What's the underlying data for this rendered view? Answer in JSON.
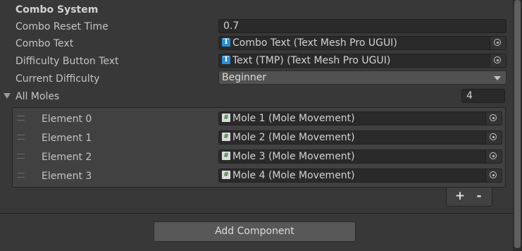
{
  "section": {
    "title": "Combo System"
  },
  "properties": {
    "combo_reset_time": {
      "label": "Combo Reset Time",
      "value": "0.7"
    },
    "combo_text": {
      "label": "Combo Text",
      "value": "Combo Text (Text Mesh Pro UGUI)",
      "icon": "textmeshpro-icon"
    },
    "difficulty_button_text": {
      "label": "Difficulty Button Text",
      "value": "Text (TMP) (Text Mesh Pro UGUI)",
      "icon": "textmeshpro-icon"
    },
    "current_difficulty": {
      "label": "Current Difficulty",
      "value": "Beginner"
    }
  },
  "all_moles": {
    "label": "All Moles",
    "count": "4",
    "elements": [
      {
        "label": "Element 0",
        "value": "Mole 1 (Mole Movement)",
        "icon": "script-icon"
      },
      {
        "label": "Element 1",
        "value": "Mole 2 (Mole Movement)",
        "icon": "script-icon"
      },
      {
        "label": "Element 2",
        "value": "Mole 3 (Mole Movement)",
        "icon": "script-icon"
      },
      {
        "label": "Element 3",
        "value": "Mole 4 (Mole Movement)",
        "icon": "script-icon"
      }
    ],
    "add_label": "+",
    "remove_label": "-"
  },
  "footer": {
    "add_component_label": "Add Component"
  }
}
